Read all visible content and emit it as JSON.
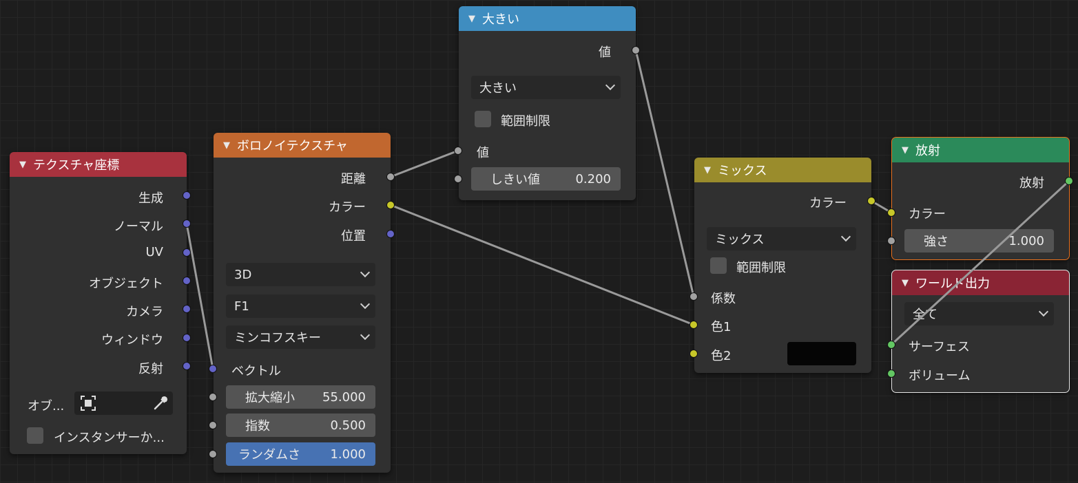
{
  "nodes": {
    "texcoord": {
      "title": "テクスチャ座標",
      "color": "#a8323e",
      "outputs": [
        "生成",
        "ノーマル",
        "UV",
        "オブジェクト",
        "カメラ",
        "ウィンドウ",
        "反射"
      ],
      "object_label": "オブ...",
      "instancer_label": "インスタンサーか..."
    },
    "voronoi": {
      "title": "ボロノイテクスチャ",
      "color": "#c1672f",
      "outputs": [
        "距離",
        "カラー",
        "位置"
      ],
      "dimensions": "3D",
      "feature": "F1",
      "metric": "ミンコフスキー",
      "vector_label": "ベクトル",
      "scale_label": "拡大縮小",
      "scale_value": "55.000",
      "exponent_label": "指数",
      "exponent_value": "0.500",
      "randomness_label": "ランダムさ",
      "randomness_value": "1.000"
    },
    "math": {
      "title": "大きい",
      "color": "#3f8dc0",
      "output": "値",
      "operation": "大きい",
      "clamp_label": "範囲制限",
      "input_label": "値",
      "threshold_label": "しきい値",
      "threshold_value": "0.200"
    },
    "mix": {
      "title": "ミックス",
      "color": "#9a8c2c",
      "output": "カラー",
      "blend": "ミックス",
      "clamp_label": "範囲制限",
      "fac_label": "係数",
      "color1_label": "色1",
      "color2_label": "色2",
      "color2_swatch": "#050505"
    },
    "emission": {
      "title": "放射",
      "color": "#2b8a5a",
      "output": "放射",
      "color_label": "カラー",
      "strength_label": "強さ",
      "strength_value": "1.000"
    },
    "world_output": {
      "title": "ワールド出力",
      "color": "#8a2434",
      "target": "全て",
      "surface_label": "サーフェス",
      "volume_label": "ボリューム"
    }
  }
}
